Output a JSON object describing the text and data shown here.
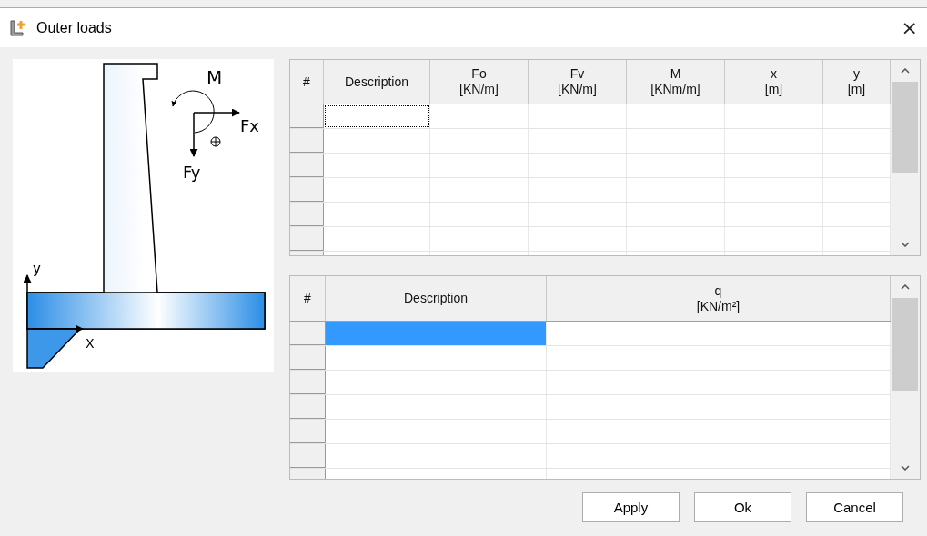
{
  "window": {
    "title": "Outer loads",
    "close": "×"
  },
  "drawing": {
    "labels": [
      {
        "kind": "moment",
        "text": "M"
      },
      {
        "kind": "fx",
        "text": "Fx"
      },
      {
        "kind": "fy",
        "text": "Fy"
      },
      {
        "kind": "axis_y",
        "text": "y"
      },
      {
        "kind": "axis_x",
        "text": "X"
      }
    ]
  },
  "tables": [
    {
      "columns": [
        {
          "label": "#"
        },
        {
          "label": "Description"
        },
        {
          "label": "Fo",
          "unit": "[KN/m]"
        },
        {
          "label": "Fv",
          "unit": "[KN/m]"
        },
        {
          "label": "M",
          "unit": "[KNm/m]"
        },
        {
          "label": "x",
          "unit": "[m]"
        },
        {
          "label": "y",
          "unit": "[m]"
        }
      ],
      "rows": [
        {
          "cells": [
            {
              "focused": true,
              "selected": false
            },
            {
              "focused": false,
              "selected": false
            },
            {
              "focused": false,
              "selected": false
            },
            {
              "focused": false,
              "selected": false
            },
            {
              "focused": false,
              "selected": false
            },
            {
              "focused": false,
              "selected": false
            }
          ]
        },
        {
          "cells": [
            {
              "focused": false,
              "selected": false
            },
            {
              "focused": false,
              "selected": false
            },
            {
              "focused": false,
              "selected": false
            },
            {
              "focused": false,
              "selected": false
            },
            {
              "focused": false,
              "selected": false
            },
            {
              "focused": false,
              "selected": false
            }
          ]
        },
        {
          "cells": [
            {
              "focused": false,
              "selected": false
            },
            {
              "focused": false,
              "selected": false
            },
            {
              "focused": false,
              "selected": false
            },
            {
              "focused": false,
              "selected": false
            },
            {
              "focused": false,
              "selected": false
            },
            {
              "focused": false,
              "selected": false
            }
          ]
        },
        {
          "cells": [
            {
              "focused": false,
              "selected": false
            },
            {
              "focused": false,
              "selected": false
            },
            {
              "focused": false,
              "selected": false
            },
            {
              "focused": false,
              "selected": false
            },
            {
              "focused": false,
              "selected": false
            },
            {
              "focused": false,
              "selected": false
            }
          ]
        },
        {
          "cells": [
            {
              "focused": false,
              "selected": false
            },
            {
              "focused": false,
              "selected": false
            },
            {
              "focused": false,
              "selected": false
            },
            {
              "focused": false,
              "selected": false
            },
            {
              "focused": false,
              "selected": false
            },
            {
              "focused": false,
              "selected": false
            }
          ]
        },
        {
          "cells": [
            {
              "focused": false,
              "selected": false
            },
            {
              "focused": false,
              "selected": false
            },
            {
              "focused": false,
              "selected": false
            },
            {
              "focused": false,
              "selected": false
            },
            {
              "focused": false,
              "selected": false
            },
            {
              "focused": false,
              "selected": false
            }
          ]
        },
        {
          "cells": [
            {
              "focused": false,
              "selected": false
            },
            {
              "focused": false,
              "selected": false
            },
            {
              "focused": false,
              "selected": false
            },
            {
              "focused": false,
              "selected": false
            },
            {
              "focused": false,
              "selected": false
            },
            {
              "focused": false,
              "selected": false
            }
          ]
        }
      ]
    },
    {
      "columns": [
        {
          "label": "#"
        },
        {
          "label": "Description"
        },
        {
          "label": "q",
          "unit": "[KN/m²]"
        }
      ],
      "rows": [
        {
          "cells": [
            {
              "focused": false,
              "selected": true
            },
            {
              "focused": false,
              "selected": false
            }
          ]
        },
        {
          "cells": [
            {
              "focused": false,
              "selected": false
            },
            {
              "focused": false,
              "selected": false
            }
          ]
        },
        {
          "cells": [
            {
              "focused": false,
              "selected": false
            },
            {
              "focused": false,
              "selected": false
            }
          ]
        },
        {
          "cells": [
            {
              "focused": false,
              "selected": false
            },
            {
              "focused": false,
              "selected": false
            }
          ]
        },
        {
          "cells": [
            {
              "focused": false,
              "selected": false
            },
            {
              "focused": false,
              "selected": false
            }
          ]
        },
        {
          "cells": [
            {
              "focused": false,
              "selected": false
            },
            {
              "focused": false,
              "selected": false
            }
          ]
        },
        {
          "cells": [
            {
              "focused": false,
              "selected": false
            },
            {
              "focused": false,
              "selected": false
            }
          ]
        }
      ]
    }
  ],
  "buttons": [
    "Apply",
    "Ok",
    "Cancel"
  ]
}
